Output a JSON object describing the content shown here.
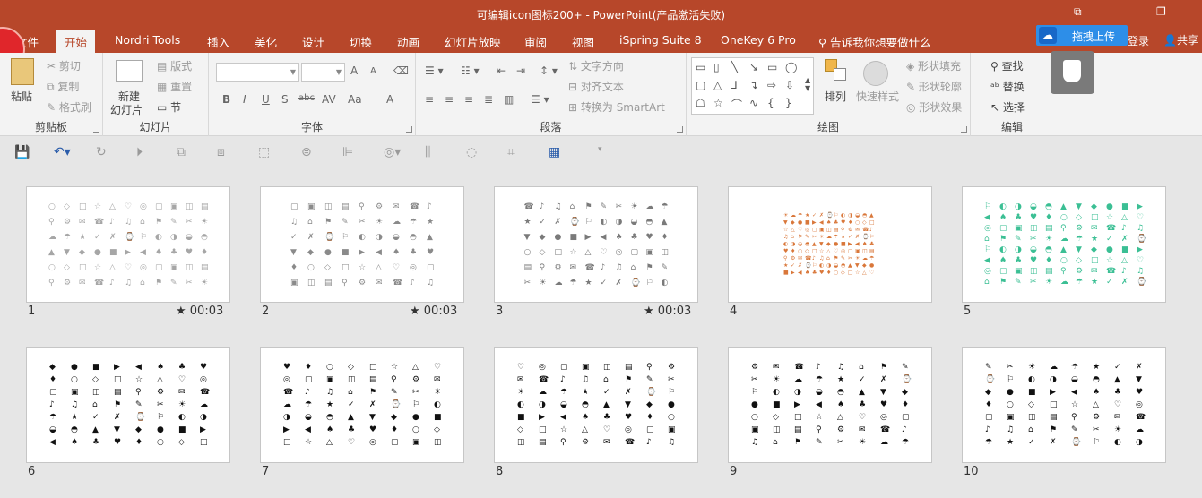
{
  "window": {
    "title": "可编辑icon图标200+ - PowerPoint(产品激活失败)",
    "restore_symbol": "⧉",
    "maximize_symbol": "❐"
  },
  "tabs": [
    "文件",
    "开始",
    "Nordri Tools",
    "插入",
    "美化",
    "设计",
    "切换",
    "动画",
    "幻灯片放映",
    "审阅",
    "视图",
    "iSpring Suite 8",
    "OneKey 6 Pro"
  ],
  "tell_me": "告诉我你想要做什么",
  "upload_button": "拖拽上传",
  "login": "登录",
  "share": "共享",
  "ribbon": {
    "clipboard": {
      "paste": "粘贴",
      "cut": "剪切",
      "copy": "复制",
      "format_painter": "格式刷",
      "label": "剪贴板"
    },
    "slides": {
      "new_slide_1": "新建",
      "new_slide_2": "幻灯片",
      "layout": "版式",
      "reset": "重置",
      "section": "节",
      "label": "幻灯片"
    },
    "font": {
      "label": "字体",
      "bold": "B",
      "italic": "I",
      "underline": "U",
      "shadow": "S",
      "strike": "abc",
      "spacing": "AV",
      "case": "Aa",
      "grow": "A",
      "shrink": "A",
      "color": "A"
    },
    "paragraph": {
      "text_direction": "文字方向",
      "align_text": "对齐文本",
      "smartart": "转换为 SmartArt",
      "label": "段落"
    },
    "drawing": {
      "arrange": "排列",
      "quick_styles": "快速样式",
      "shape_fill": "形状填充",
      "shape_outline": "形状轮廓",
      "shape_effects": "形状效果",
      "label": "绘图"
    },
    "editing": {
      "find": "查找",
      "replace": "替换",
      "select": "选择",
      "label": "编辑"
    }
  },
  "slides": [
    {
      "number": "1",
      "time": "★ 00:03",
      "icon_color": "#a6a6a6",
      "grid": "A"
    },
    {
      "number": "2",
      "time": "★ 00:03",
      "icon_color": "#8a8a8a",
      "grid": "B"
    },
    {
      "number": "3",
      "time": "★ 00:03",
      "icon_color": "#7a7a7a",
      "grid": "C"
    },
    {
      "number": "4",
      "time": "",
      "icon_color": "#d9773a",
      "grid": "D"
    },
    {
      "number": "5",
      "time": "",
      "icon_color": "#3bbf94",
      "grid": "E"
    },
    {
      "number": "6",
      "time": "",
      "icon_color": "#111111",
      "grid": "F"
    },
    {
      "number": "7",
      "time": "",
      "icon_color": "#111111",
      "grid": "G"
    },
    {
      "number": "8",
      "time": "",
      "icon_color": "#111111",
      "grid": "H"
    },
    {
      "number": "9",
      "time": "",
      "icon_color": "#111111",
      "grid": "I"
    },
    {
      "number": "10",
      "time": "",
      "icon_color": "#111111",
      "grid": "J"
    }
  ]
}
